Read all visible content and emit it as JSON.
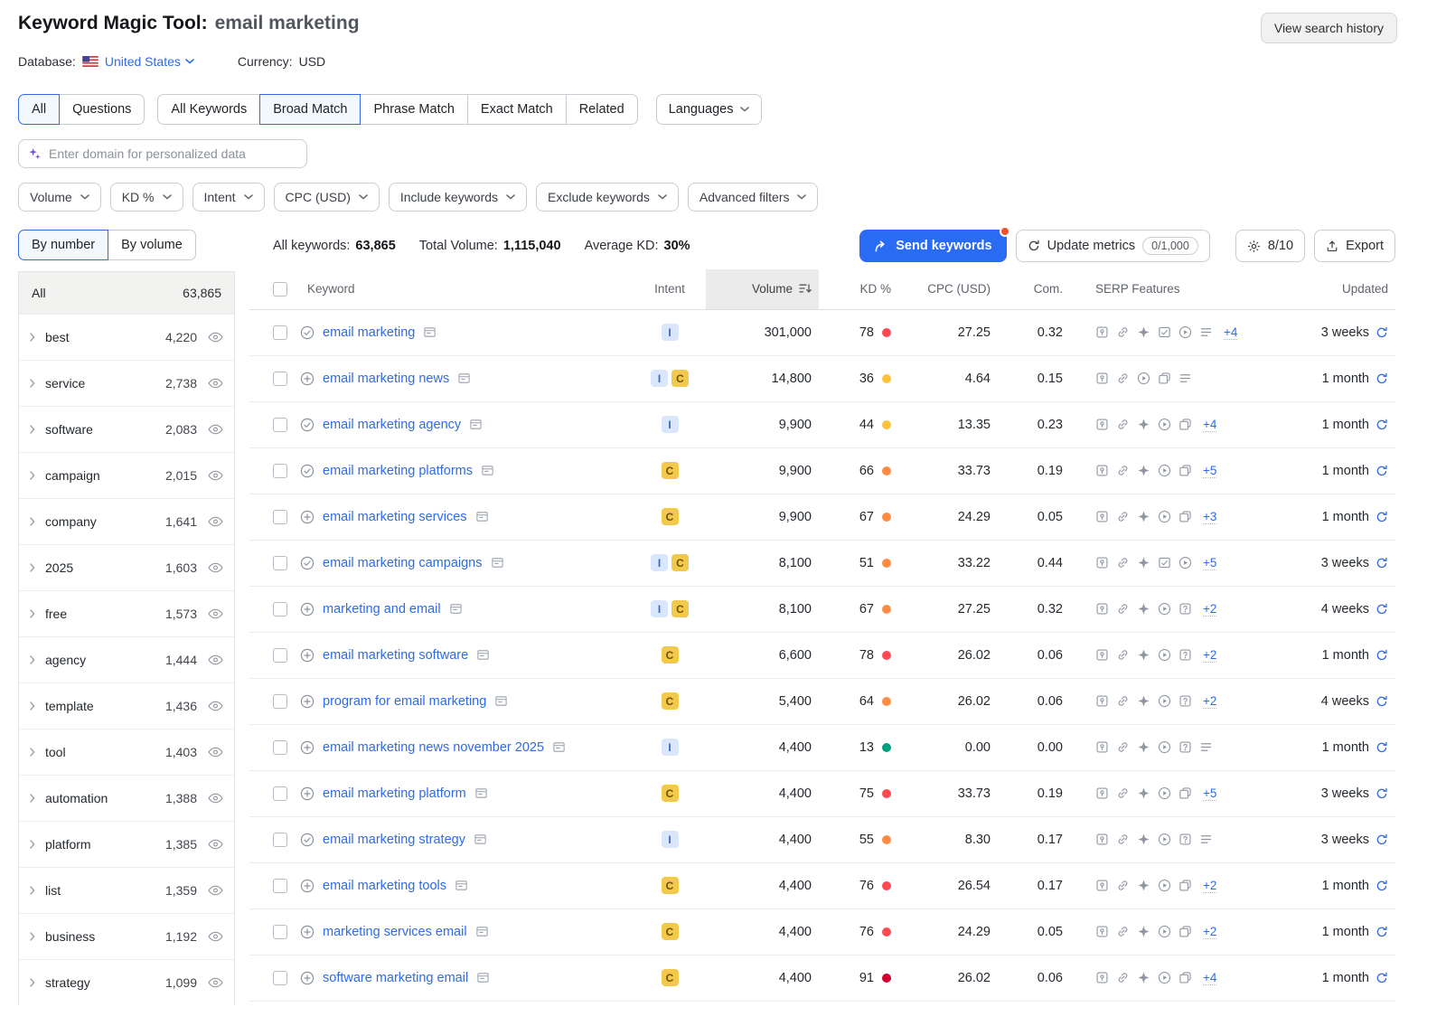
{
  "header": {
    "title": "Keyword Magic Tool:",
    "query": "email marketing",
    "view_search_history": "View search history",
    "database_label": "Database:",
    "database_value": "United States",
    "currency_label": "Currency:",
    "currency_value": "USD"
  },
  "tabs": {
    "group1": [
      {
        "label": "All",
        "selected": true
      },
      {
        "label": "Questions",
        "selected": false
      }
    ],
    "group2": [
      {
        "label": "All Keywords",
        "selected": false
      },
      {
        "label": "Broad Match",
        "selected": true
      },
      {
        "label": "Phrase Match",
        "selected": false
      },
      {
        "label": "Exact Match",
        "selected": false
      },
      {
        "label": "Related",
        "selected": false
      }
    ],
    "languages": "Languages"
  },
  "domain_input": {
    "placeholder": "Enter domain for personalized data"
  },
  "filters": [
    {
      "label": "Volume"
    },
    {
      "label": "KD %"
    },
    {
      "label": "Intent"
    },
    {
      "label": "CPC (USD)"
    },
    {
      "label": "Include keywords"
    },
    {
      "label": "Exclude keywords"
    },
    {
      "label": "Advanced filters"
    }
  ],
  "sidebar": {
    "toggle": [
      {
        "label": "By number",
        "selected": true
      },
      {
        "label": "By volume",
        "selected": false
      }
    ],
    "all": {
      "label": "All",
      "count": "63,865"
    },
    "groups": [
      {
        "label": "best",
        "count": "4,220"
      },
      {
        "label": "service",
        "count": "2,738"
      },
      {
        "label": "software",
        "count": "2,083"
      },
      {
        "label": "campaign",
        "count": "2,015"
      },
      {
        "label": "company",
        "count": "1,641"
      },
      {
        "label": "2025",
        "count": "1,603"
      },
      {
        "label": "free",
        "count": "1,573"
      },
      {
        "label": "agency",
        "count": "1,444"
      },
      {
        "label": "template",
        "count": "1,436"
      },
      {
        "label": "tool",
        "count": "1,403"
      },
      {
        "label": "automation",
        "count": "1,388"
      },
      {
        "label": "platform",
        "count": "1,385"
      },
      {
        "label": "list",
        "count": "1,359"
      },
      {
        "label": "business",
        "count": "1,192"
      },
      {
        "label": "strategy",
        "count": "1,099"
      }
    ]
  },
  "summary": {
    "all_keywords_label": "All keywords:",
    "all_keywords_value": "63,865",
    "total_volume_label": "Total Volume:",
    "total_volume_value": "1,115,040",
    "average_kd_label": "Average KD:",
    "average_kd_value": "30%",
    "send_keywords_label": "Send keywords",
    "update_metrics_label": "Update metrics",
    "update_metrics_quota": "0/1,000",
    "api_quota": "8/10",
    "export_label": "Export"
  },
  "table": {
    "sorted_by": "Volume",
    "columns": {
      "keyword": "Keyword",
      "intent": "Intent",
      "volume": "Volume",
      "kd": "KD %",
      "cpc": "CPC (USD)",
      "com": "Com.",
      "serp": "SERP Features",
      "updated": "Updated"
    },
    "rows": [
      {
        "keyword": "email marketing",
        "action": "check",
        "intents": [
          "I"
        ],
        "volume": "301,000",
        "kd": "78",
        "kd_color": "#ff4953",
        "cpc": "27.25",
        "com": "0.32",
        "serp_icons": [
          "local",
          "link",
          "reviews",
          "snippet",
          "video",
          "list"
        ],
        "serp_more": "+4",
        "updated": "3 weeks"
      },
      {
        "keyword": "email marketing news",
        "action": "plus",
        "intents": [
          "I",
          "C"
        ],
        "volume": "14,800",
        "kd": "36",
        "kd_color": "#fdc23c",
        "cpc": "4.64",
        "com": "0.15",
        "serp_icons": [
          "local",
          "link",
          "video",
          "carousel",
          "list"
        ],
        "serp_more": "",
        "updated": "1 month"
      },
      {
        "keyword": "email marketing agency",
        "action": "check",
        "intents": [
          "I"
        ],
        "volume": "9,900",
        "kd": "44",
        "kd_color": "#fdc23c",
        "cpc": "13.35",
        "com": "0.23",
        "serp_icons": [
          "local",
          "link",
          "reviews",
          "video",
          "carousel"
        ],
        "serp_more": "+4",
        "updated": "1 month"
      },
      {
        "keyword": "email marketing platforms",
        "action": "check",
        "intents": [
          "C"
        ],
        "volume": "9,900",
        "kd": "66",
        "kd_color": "#ff8c43",
        "cpc": "33.73",
        "com": "0.19",
        "serp_icons": [
          "local",
          "link",
          "reviews",
          "video",
          "carousel"
        ],
        "serp_more": "+5",
        "updated": "1 month"
      },
      {
        "keyword": "email marketing services",
        "action": "plus",
        "intents": [
          "C"
        ],
        "volume": "9,900",
        "kd": "67",
        "kd_color": "#ff8c43",
        "cpc": "24.29",
        "com": "0.05",
        "serp_icons": [
          "local",
          "link",
          "reviews",
          "video",
          "carousel"
        ],
        "serp_more": "+3",
        "updated": "1 month"
      },
      {
        "keyword": "email marketing campaigns",
        "action": "check",
        "intents": [
          "I",
          "C"
        ],
        "volume": "8,100",
        "kd": "51",
        "kd_color": "#ff8c43",
        "cpc": "33.22",
        "com": "0.44",
        "serp_icons": [
          "local",
          "link",
          "reviews",
          "snippet",
          "video"
        ],
        "serp_more": "+5",
        "updated": "3 weeks"
      },
      {
        "keyword": "marketing and email",
        "action": "plus",
        "intents": [
          "I",
          "C"
        ],
        "volume": "8,100",
        "kd": "67",
        "kd_color": "#ff8c43",
        "cpc": "27.25",
        "com": "0.32",
        "serp_icons": [
          "local",
          "link",
          "reviews",
          "video",
          "question"
        ],
        "serp_more": "+2",
        "updated": "4 weeks"
      },
      {
        "keyword": "email marketing software",
        "action": "plus",
        "intents": [
          "C"
        ],
        "volume": "6,600",
        "kd": "78",
        "kd_color": "#ff4953",
        "cpc": "26.02",
        "com": "0.06",
        "serp_icons": [
          "local",
          "link",
          "reviews",
          "video",
          "question"
        ],
        "serp_more": "+2",
        "updated": "1 month"
      },
      {
        "keyword": "program for email marketing",
        "action": "plus",
        "intents": [
          "C"
        ],
        "volume": "5,400",
        "kd": "64",
        "kd_color": "#ff8c43",
        "cpc": "26.02",
        "com": "0.06",
        "serp_icons": [
          "local",
          "link",
          "reviews",
          "video",
          "question"
        ],
        "serp_more": "+2",
        "updated": "4 weeks"
      },
      {
        "keyword": "email marketing news november 2025",
        "action": "plus",
        "intents": [
          "I"
        ],
        "volume": "4,400",
        "kd": "13",
        "kd_color": "#009f81",
        "cpc": "0.00",
        "com": "0.00",
        "serp_icons": [
          "local",
          "link",
          "reviews",
          "video",
          "question",
          "list"
        ],
        "serp_more": "",
        "updated": "1 month"
      },
      {
        "keyword": "email marketing platform",
        "action": "plus",
        "intents": [
          "C"
        ],
        "volume": "4,400",
        "kd": "75",
        "kd_color": "#ff4953",
        "cpc": "33.73",
        "com": "0.19",
        "serp_icons": [
          "local",
          "link",
          "reviews",
          "video",
          "carousel"
        ],
        "serp_more": "+5",
        "updated": "3 weeks"
      },
      {
        "keyword": "email marketing strategy",
        "action": "check",
        "intents": [
          "I"
        ],
        "volume": "4,400",
        "kd": "55",
        "kd_color": "#ff8c43",
        "cpc": "8.30",
        "com": "0.17",
        "serp_icons": [
          "local",
          "link",
          "reviews",
          "video",
          "question",
          "list"
        ],
        "serp_more": "",
        "updated": "3 weeks"
      },
      {
        "keyword": "email marketing tools",
        "action": "plus",
        "intents": [
          "C"
        ],
        "volume": "4,400",
        "kd": "76",
        "kd_color": "#ff4953",
        "cpc": "26.54",
        "com": "0.17",
        "serp_icons": [
          "local",
          "link",
          "reviews",
          "video",
          "carousel"
        ],
        "serp_more": "+2",
        "updated": "1 month"
      },
      {
        "keyword": "marketing services email",
        "action": "plus",
        "intents": [
          "C"
        ],
        "volume": "4,400",
        "kd": "76",
        "kd_color": "#ff4953",
        "cpc": "24.29",
        "com": "0.05",
        "serp_icons": [
          "local",
          "link",
          "reviews",
          "video",
          "carousel"
        ],
        "serp_more": "+2",
        "updated": "1 month"
      },
      {
        "keyword": "software marketing email",
        "action": "plus",
        "intents": [
          "C"
        ],
        "volume": "4,400",
        "kd": "91",
        "kd_color": "#d1002f",
        "cpc": "26.02",
        "com": "0.06",
        "serp_icons": [
          "local",
          "link",
          "reviews",
          "video",
          "carousel"
        ],
        "serp_more": "+4",
        "updated": "1 month"
      }
    ]
  },
  "colors": {
    "accent_blue": "#2a6bf3",
    "link_blue": "#2e6be5",
    "kd_green": "#009f81",
    "kd_yellow": "#fdc23c",
    "kd_orange": "#ff8c43",
    "kd_red": "#ff4953",
    "kd_dark_red": "#d1002f",
    "intent_informational_bg": "#d9e6fb",
    "intent_informational_fg": "#3467c9",
    "intent_commercial_bg": "#f2c94c",
    "intent_commercial_fg": "#6e5300",
    "notification_orange": "#f4502c",
    "sparkle_purple": "#7a52e8"
  }
}
